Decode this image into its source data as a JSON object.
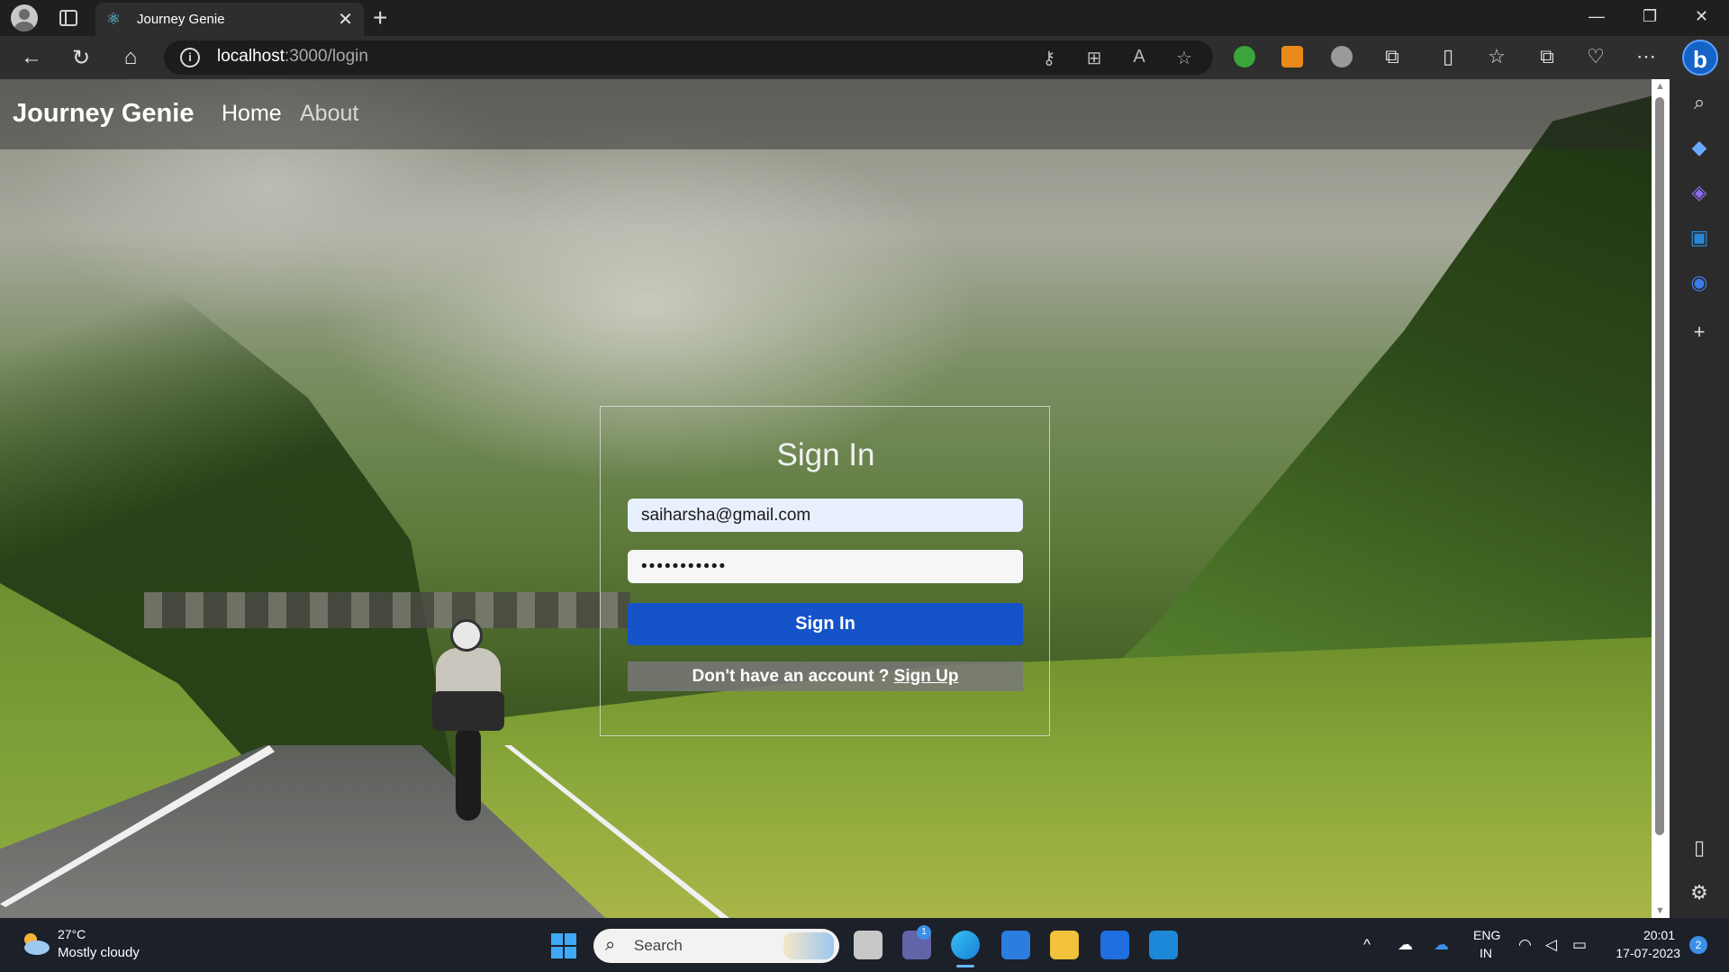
{
  "browser": {
    "tab_title": "Journey Genie",
    "url_host": "localhost",
    "url_path": ":3000/login"
  },
  "navbar": {
    "brand": "Journey Genie",
    "links": [
      "Home",
      "About"
    ]
  },
  "login": {
    "title": "Sign In",
    "email_value": "saiharsha@gmail.com",
    "password_value": "•••••••••••",
    "submit_label": "Sign In",
    "signup_prompt": "Don't have an account ? ",
    "signup_link": "Sign Up"
  },
  "taskbar": {
    "weather_temp": "27°C",
    "weather_desc": "Mostly cloudy",
    "search_placeholder": "Search",
    "language": "ENG",
    "region": "IN",
    "time": "20:01",
    "date": "17-07-2023",
    "notification_count": "2",
    "teams_badge": "1"
  },
  "colors": {
    "primary_button": "#1553c9",
    "browser_bg": "#2e2e2e",
    "taskbar_bg": "#1c2028"
  }
}
